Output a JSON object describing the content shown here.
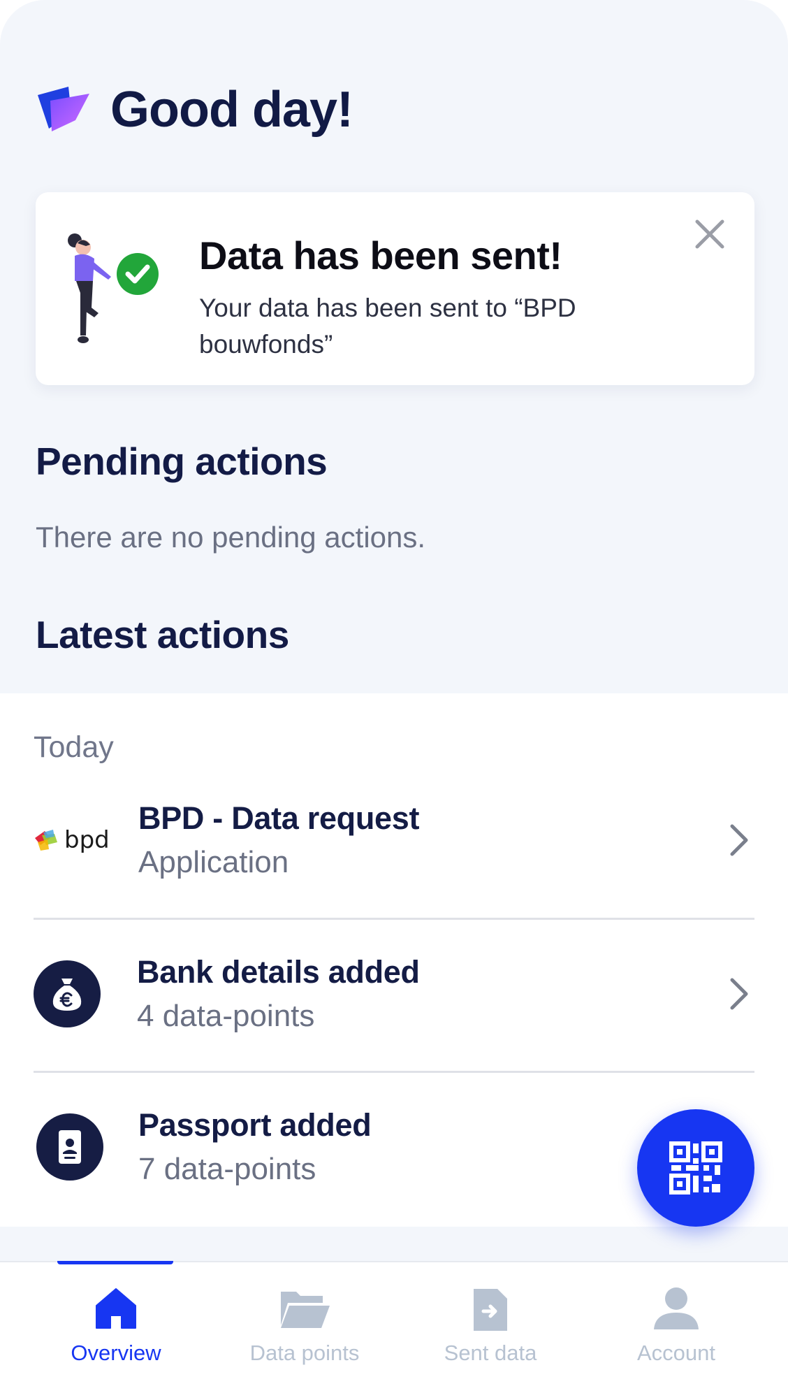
{
  "header": {
    "greeting": "Good day!"
  },
  "notification": {
    "title": "Data has been sent!",
    "message": "Your data has been sent to “BPD bouwfonds”"
  },
  "pending": {
    "title": "Pending actions",
    "empty_text": "There are no pending actions."
  },
  "latest": {
    "title": "Latest actions",
    "day_label": "Today",
    "items": [
      {
        "icon": "bpd-logo",
        "logo_text": "bpd",
        "title": "BPD - Data request",
        "subtitle": "Application"
      },
      {
        "icon": "money-bag-euro-icon",
        "title": "Bank details added",
        "subtitle": "4 data-points"
      },
      {
        "icon": "passport-icon",
        "title": "Passport added",
        "subtitle": "7 data-points"
      }
    ]
  },
  "fab": {
    "icon": "qr-code-icon"
  },
  "nav": {
    "active": "Overview",
    "items": [
      {
        "label": "Overview",
        "icon": "home-icon"
      },
      {
        "label": "Data points",
        "icon": "folder-icon"
      },
      {
        "label": "Sent data",
        "icon": "sent-file-icon"
      },
      {
        "label": "Account",
        "icon": "user-icon"
      }
    ]
  },
  "colors": {
    "primary": "#1736f2",
    "navy": "#141c45",
    "background": "#f3f6fb",
    "success": "#22a63a",
    "muted": "#6a7083",
    "nav_inactive": "#b7c2d1"
  }
}
